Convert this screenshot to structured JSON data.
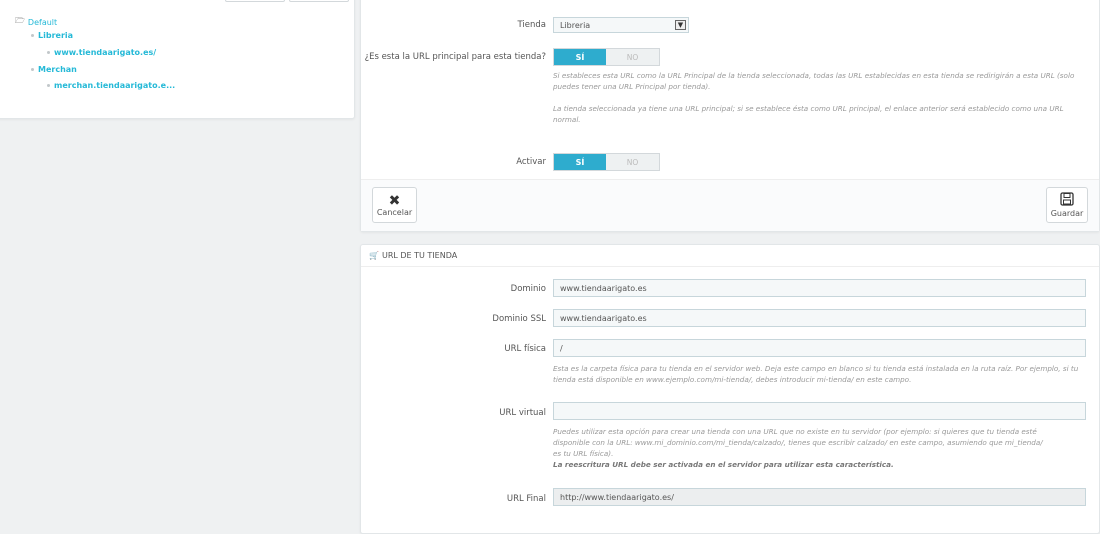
{
  "tree": {
    "root": "Default",
    "groups": [
      {
        "name": "Libreria",
        "url": "www.tiendaarigato.es/"
      },
      {
        "name": "Merchan",
        "url": "merchan.tiendaarigato.e..."
      }
    ]
  },
  "form": {
    "shop_label": "Tienda",
    "shop_value": "Libreria",
    "main_url_label": "¿Es esta la URL principal para esta tienda?",
    "yes": "SÍ",
    "no": "NO",
    "main_url_help1": "Si estableces esta URL como la URL Principal de la tienda seleccionada, todas las URL establecidas en esta tienda se redirigirán a esta URL (solo puedes tener una URL Principal por tienda).",
    "main_url_help2": "La tienda seleccionada ya tiene una URL principal; si se establece ésta como URL principal, el enlace anterior será establecido como una URL normal.",
    "activate_label": "Activar",
    "cancel": "Cancelar",
    "save": "Guardar"
  },
  "url_panel": {
    "title": "URL DE TU TIENDA",
    "domain_label": "Dominio",
    "domain_value": "www.tiendaarigato.es",
    "ssl_label": "Dominio SSL",
    "ssl_value": "www.tiendaarigato.es",
    "physical_label": "URL física",
    "physical_value": "/",
    "physical_help": "Esta es la carpeta física para tu tienda en el servidor web. Deja este campo en blanco si tu tienda está instalada en la ruta raíz. Por ejemplo, si tu tienda está disponible en www.ejemplo.com/mi-tienda/, debes introducir mi-tienda/ en este campo.",
    "virtual_label": "URL virtual",
    "virtual_value": "",
    "virtual_help": "Puedes utilizar esta opción para crear una tienda con una URL que no existe en tu servidor (por ejemplo: si quieres que tu tienda esté disponible con la URL: www.mi_dominio.com/mi_tienda/calzado/, tienes que escribir calzado/ en este campo, asumiendo que mi_tienda/ es tu URL física).",
    "virtual_help_bold": "La reescritura URL debe ser activada en el servidor para utilizar esta característica.",
    "final_label": "URL Final",
    "final_value": "http://www.tiendaarigato.es/"
  }
}
